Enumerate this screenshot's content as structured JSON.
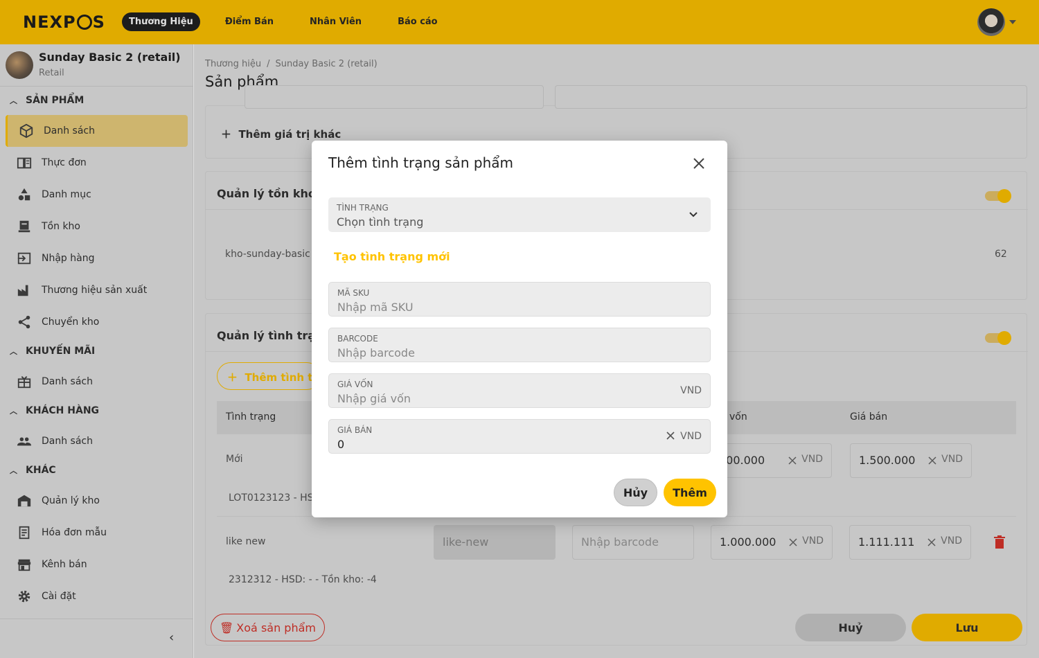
{
  "brand": {
    "logo": "NEXPOS",
    "accent": "#FFC300"
  },
  "topnav": {
    "items": [
      "Thương Hiệu",
      "Điểm Bán",
      "Nhân Viên",
      "Báo cáo"
    ],
    "active": "Thương Hiệu"
  },
  "store": {
    "name": "Sunday Basic 2 (retail)",
    "type": "Retail"
  },
  "sidebar": {
    "sections": [
      {
        "title": "SẢN PHẨM",
        "items": [
          "Danh sách",
          "Thực đơn",
          "Danh mục",
          "Tồn kho",
          "Nhập hàng",
          "Thương hiệu sản xuất",
          "Chuyển kho"
        ]
      },
      {
        "title": "KHUYẾN MÃI",
        "items": [
          "Danh sách"
        ]
      },
      {
        "title": "KHÁCH HÀNG",
        "items": [
          "Danh sách"
        ]
      },
      {
        "title": "KHÁC",
        "items": [
          "Quản lý kho",
          "Hóa đơn mẫu",
          "Kênh bán",
          "Cài đặt"
        ]
      }
    ]
  },
  "breadcrumb": {
    "root": "Thương hiệu",
    "sep": "/",
    "current": "Sunday Basic 2 (retail)"
  },
  "page_title": "Sản phẩm",
  "background": {
    "add_value": "Thêm giá trị khác",
    "inventory_title": "Quản lý tồn kho",
    "warehouse": "kho-sunday-basic",
    "warehouse_qty": "62",
    "status_title": "Quản lý tình trạng",
    "add_status_btn": "Thêm tình tr",
    "col_status": "Tình trạng",
    "col_cost": "vốn",
    "col_price": "Giá bán",
    "row1_status": "Mới",
    "row1_cost": "000.000",
    "row1_price": "1.500.000",
    "row1_lot": "LOT0123123 - HSD",
    "row2_status": "like new",
    "row2_sku": "like-new",
    "row2_barcode_placeholder": "Nhập barcode",
    "row2_cost": "1.000.000",
    "row2_price": "1.111.111",
    "row2_lot": "2312312 - HSD: - - Tồn kho: -4",
    "unit": "VND",
    "delete_product": "Xoá sản phẩm",
    "cancel": "Huỷ",
    "save": "Lưu"
  },
  "modal": {
    "title": "Thêm tình trạng sản phẩm",
    "status_label": "TÌNH TRẠNG",
    "status_placeholder": "Chọn tình trạng",
    "create_link": "Tạo tình trạng mới",
    "sku_label": "MÃ SKU",
    "sku_placeholder": "Nhập mã SKU",
    "barcode_label": "BARCODE",
    "barcode_placeholder": "Nhập barcode",
    "cost_label": "GIÁ VỐN",
    "cost_placeholder": "Nhập giá vốn",
    "cost_unit": "VND",
    "price_label": "GIÁ BÁN",
    "price_value": "0",
    "price_unit": "VND",
    "cancel": "Hủy",
    "add": "Thêm"
  }
}
